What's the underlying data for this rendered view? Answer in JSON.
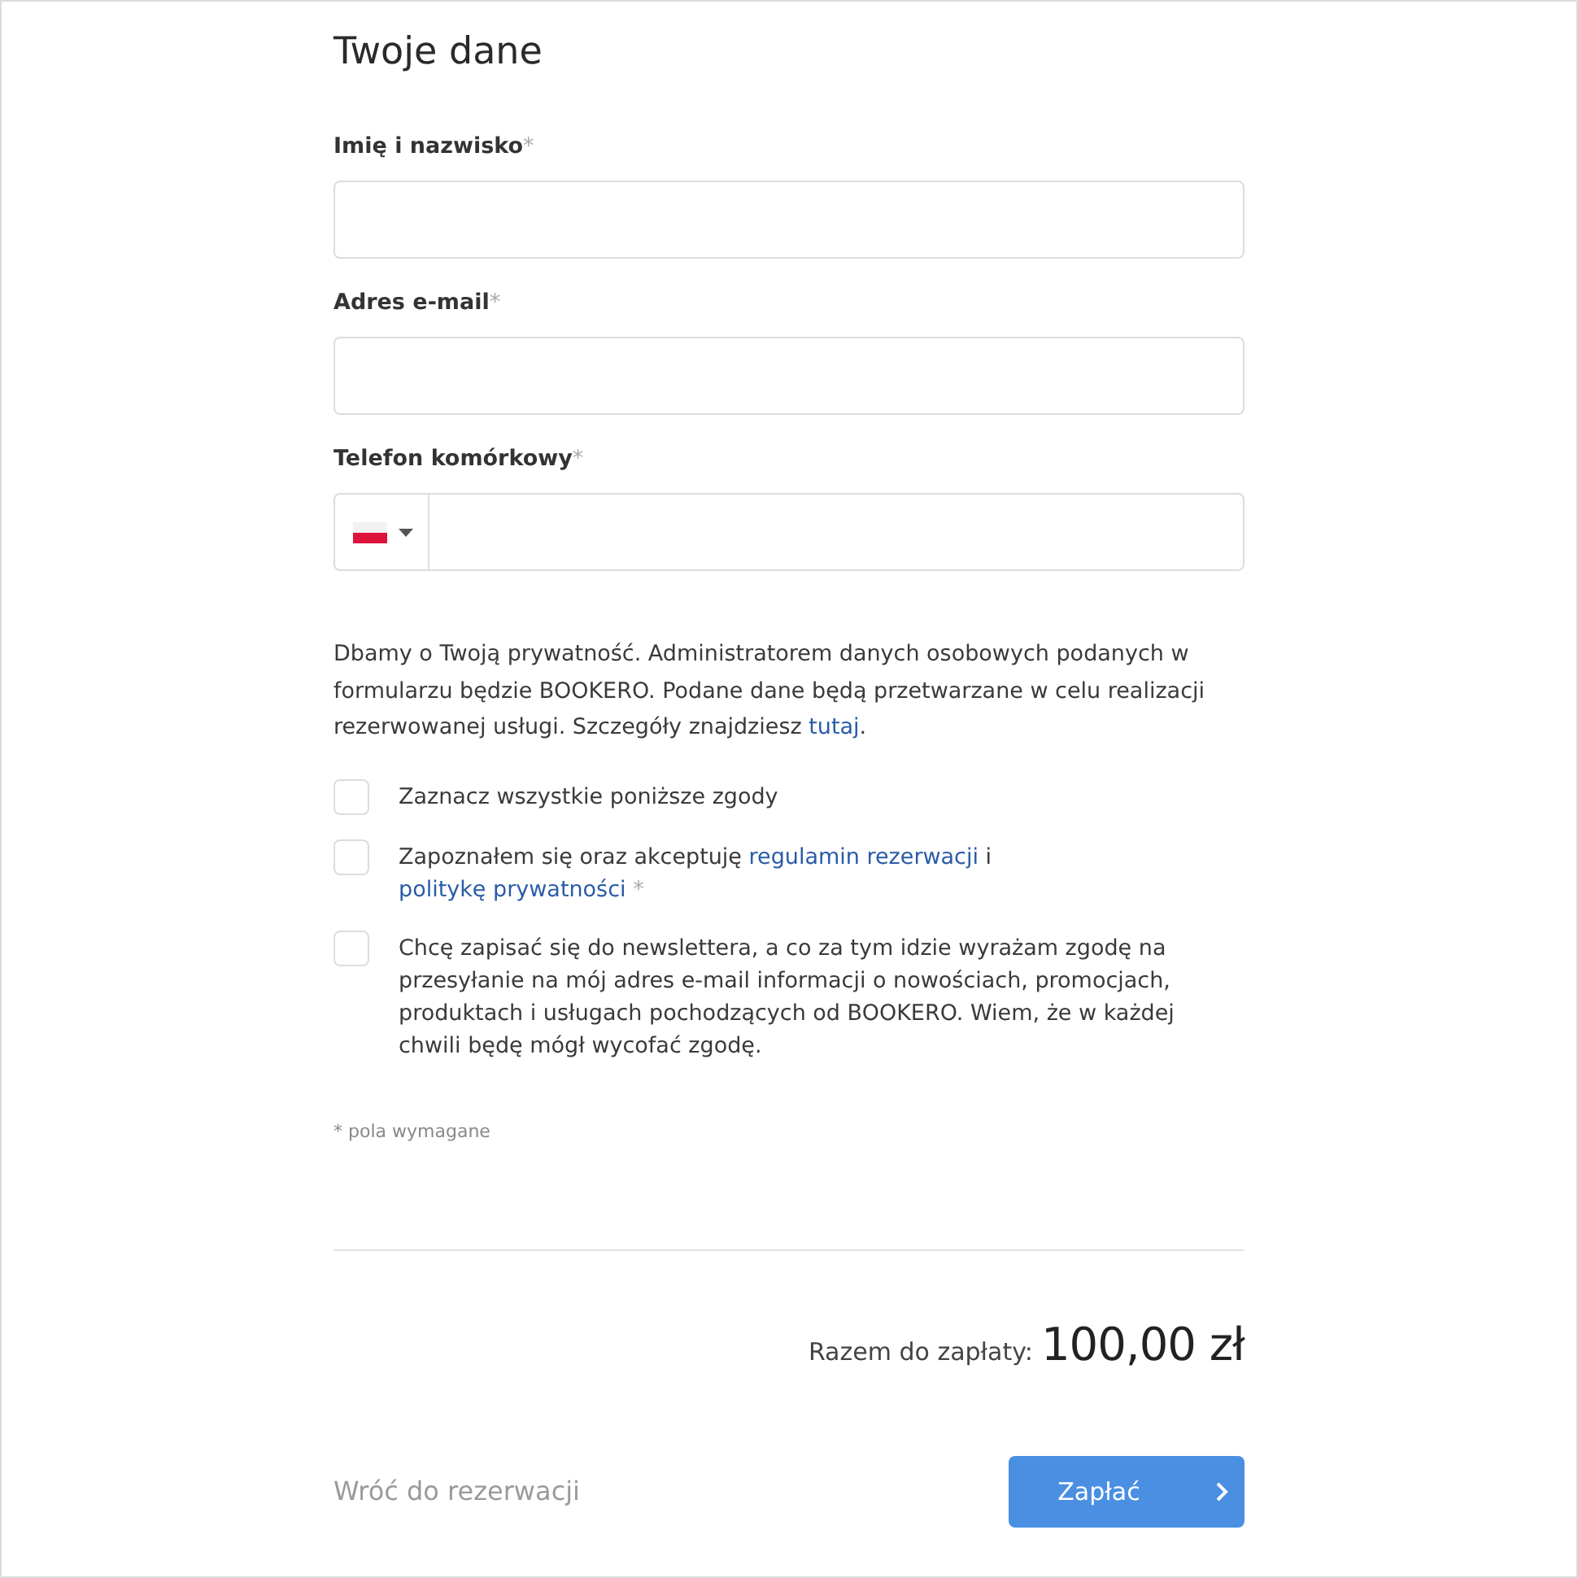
{
  "heading": "Twoje dane",
  "fields": [
    {
      "kind": "text",
      "label": "Imię i nazwisko",
      "required_mark": "*"
    },
    {
      "kind": "email",
      "label": "Adres e-mail",
      "required_mark": "*"
    },
    {
      "kind": "phone",
      "label": "Telefon komórkowy",
      "required_mark": "*"
    }
  ],
  "privacy_notice": [
    {
      "kind": "text",
      "text": "Dbamy o Twoją prywatność. Administratorem danych osobowych podanych w formularzu będzie BOOKERO. Podane dane będą przetwarzane w celu realizacji rezerwowanej usługi. Szczegóły znajdziesz "
    },
    {
      "kind": "link",
      "text": "tutaj"
    },
    {
      "kind": "text",
      "text": "."
    }
  ],
  "consents": [
    {
      "checked": false,
      "parts": [
        {
          "kind": "text",
          "text": "Zaznacz wszystkie poniższe zgody"
        }
      ]
    },
    {
      "checked": false,
      "parts": [
        {
          "kind": "text",
          "text": "Zapoznałem się oraz akceptuję "
        },
        {
          "kind": "link",
          "text": "regulamin rezerwacji"
        },
        {
          "kind": "text",
          "text": " i "
        },
        {
          "kind": "link",
          "text": "politykę prywatności"
        },
        {
          "kind": "mark",
          "text": " *"
        }
      ]
    },
    {
      "checked": false,
      "parts": [
        {
          "kind": "text",
          "text": "Chcę zapisać się do newslettera, a co za tym idzie wyrażam zgodę na przesyłanie na mój adres e-mail informacji o nowościach, promocjach, produktach i usługach pochodzących od BOOKERO. Wiem, że w każdej chwili będę mógł wycofać zgodę."
        }
      ]
    }
  ],
  "required_note": "* pola wymagane",
  "total": {
    "label": "Razem do zapłaty:",
    "amount": "100,00 zł"
  },
  "back_link": "Wróć do rezerwacji",
  "pay_button": {
    "label": "Zapłać"
  }
}
